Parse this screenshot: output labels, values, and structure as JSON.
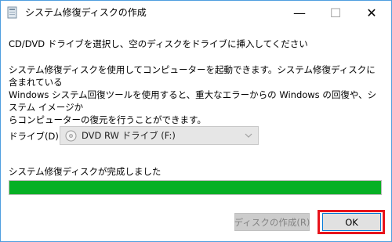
{
  "window": {
    "title": "システム修復ディスクの作成",
    "minimize_symbol": "—",
    "maximize_symbol": "☐",
    "close_symbol": "✕"
  },
  "content": {
    "heading": "CD/DVD ドライブを選択し、空のディスクをドライブに挿入してください",
    "description": "システム修復ディスクを使用してコンピューターを起動できます。システム修復ディスクに含まれている\nWindows システム回復ツールを使用すると、重大なエラーからの Windows の回復や、システム イメージか\nらコンピューターの復元を行うことができます。",
    "drive_label": "ドライブ(D):",
    "drive_value": "DVD RW ドライブ (F:)",
    "status_text": "システム修復ディスクが完成しました",
    "progress": 1.0
  },
  "buttons": {
    "create_label": "ディスクの作成(R)",
    "ok_label": "OK"
  },
  "colors": {
    "progress_fill": "#06b025",
    "highlight": "#e8141c",
    "ok_border": "#0078d7"
  },
  "icons": {
    "app": "disc-app-icon",
    "drive": "disc-icon",
    "dropdown": "chevron-down-icon"
  }
}
